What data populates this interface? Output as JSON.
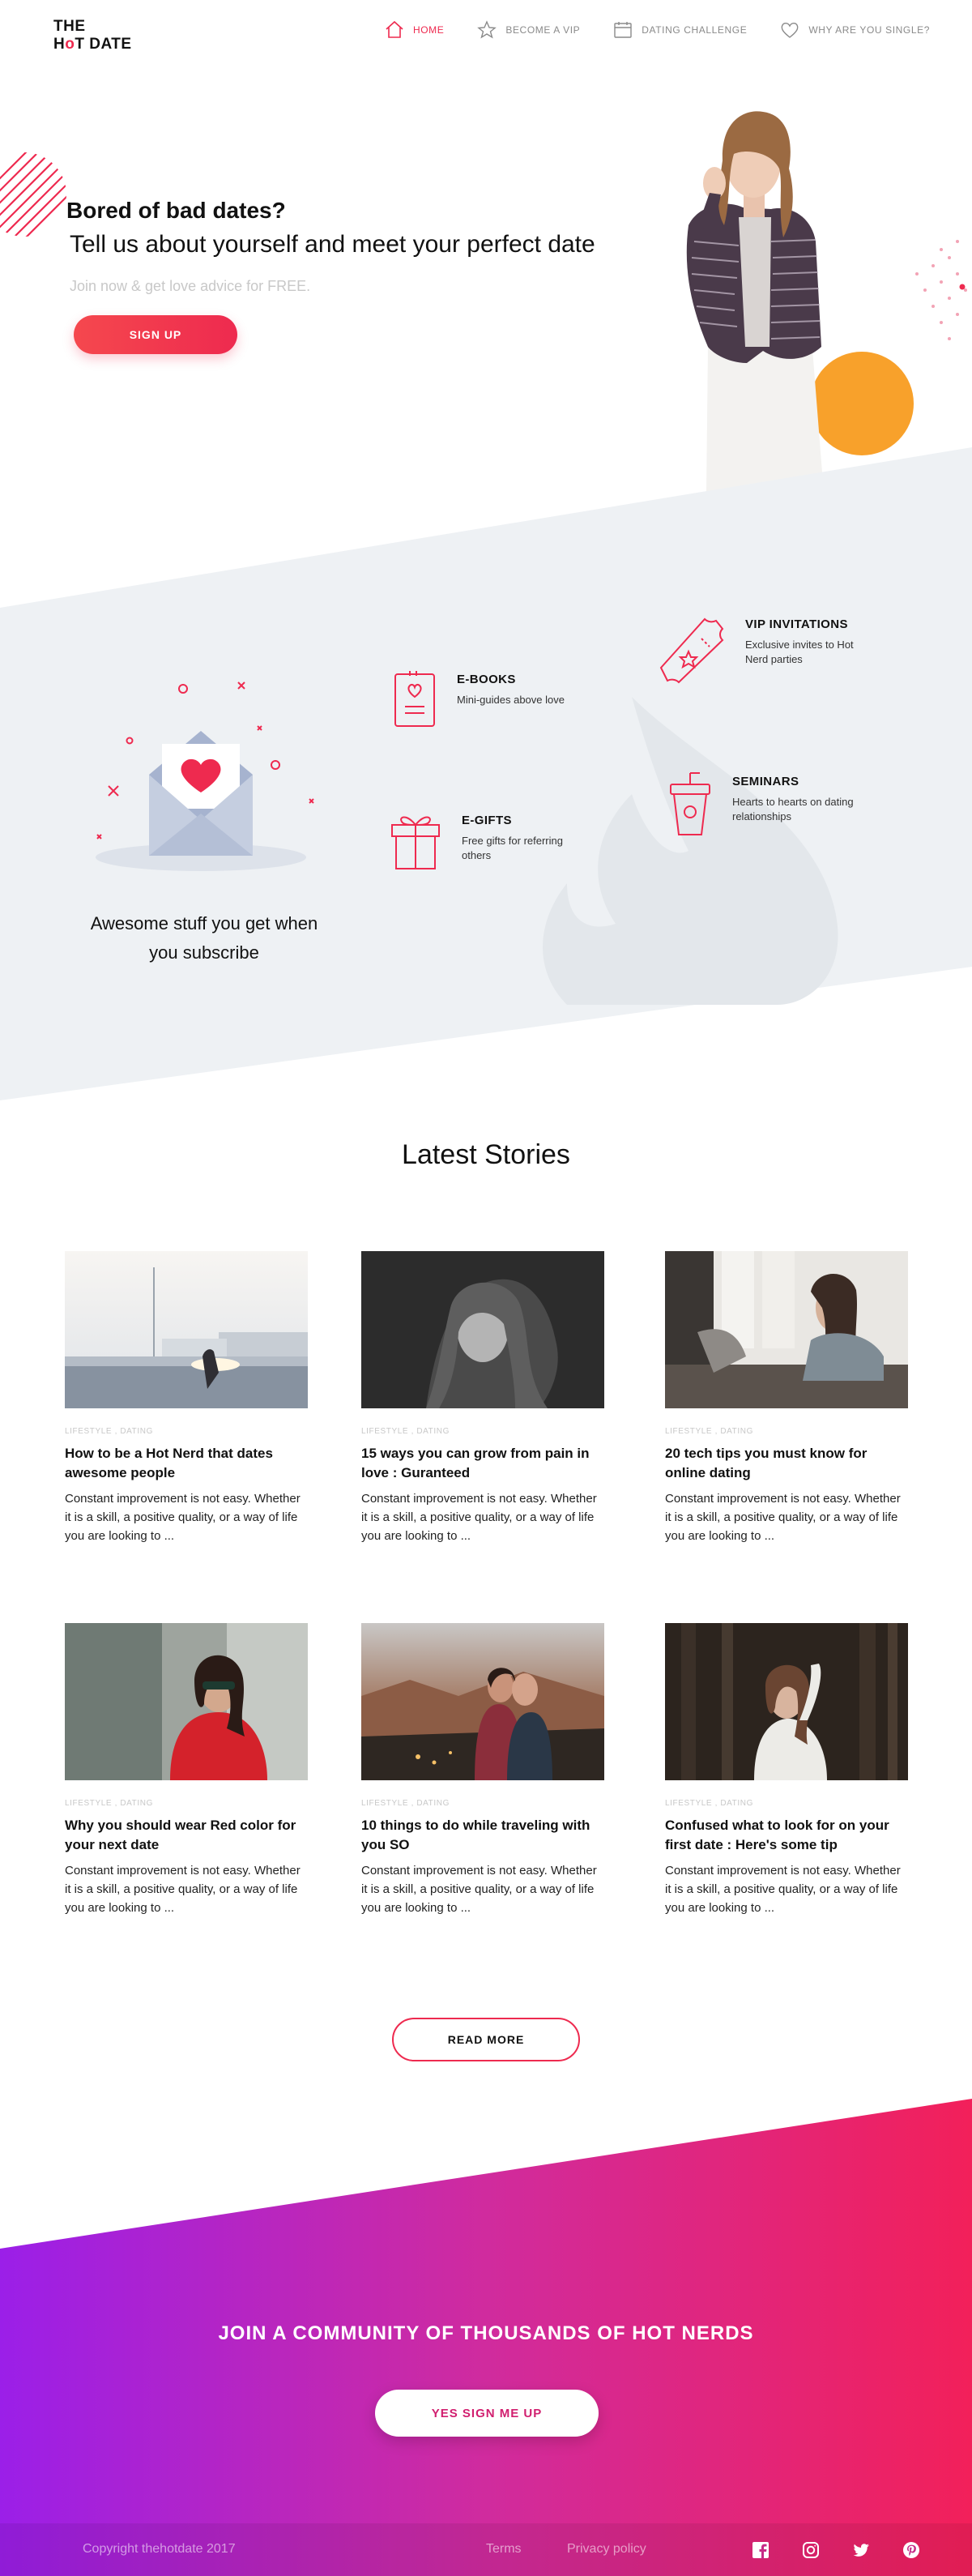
{
  "brand": {
    "line1": "THE",
    "line2_pre": "H",
    "line2_o": "o",
    "line2_post": "T DATE"
  },
  "nav": [
    {
      "label": "HOME",
      "icon": "home-icon",
      "active": true
    },
    {
      "label": "BECOME A VIP",
      "icon": "star-icon"
    },
    {
      "label": "DATING CHALLENGE",
      "icon": "calendar-icon"
    },
    {
      "label": "WHY ARE YOU SINGLE?",
      "icon": "heart-icon"
    }
  ],
  "hero": {
    "title": "Bored of bad dates?",
    "subtitle": "Tell us about yourself and meet your perfect date",
    "note": "Join now & get love advice for FREE.",
    "cta": "SIGN UP"
  },
  "features": {
    "subscribe_text": "Awesome stuff you get when you subscribe",
    "items": [
      {
        "title": "E-BOOKS",
        "desc": "Mini-guides above love",
        "icon": "ebook-icon"
      },
      {
        "title": "E-GIFTS",
        "desc": "Free gifts for referring others",
        "icon": "gift-icon"
      },
      {
        "title": "VIP INVITATIONS",
        "desc": "Exclusive invites to Hot Nerd parties",
        "icon": "ticket-icon"
      },
      {
        "title": "SEMINARS",
        "desc": "Hearts to hearts on dating relationships",
        "icon": "drink-icon"
      }
    ]
  },
  "stories": {
    "title": "Latest Stories",
    "read_more": "READ MORE",
    "items": [
      {
        "category": "LIFESTYLE , DATING",
        "title": "How to be a Hot Nerd that dates awesome people",
        "excerpt": "Constant improvement is not easy. Whether it is a skill, a positive quality, or a way of life you are looking to ..."
      },
      {
        "category": "LIFESTYLE , DATING",
        "title": "15 ways you can grow from pain in love : Guranteed",
        "excerpt": "Constant improvement is not easy. Whether it is a skill, a positive quality, or a way of life you are looking to ..."
      },
      {
        "category": "LIFESTYLE , DATING",
        "title": "20 tech tips you must know for online dating",
        "excerpt": "Constant improvement is not easy. Whether it is a skill, a positive quality, or a way of life you are looking to ..."
      },
      {
        "category": "LIFESTYLE , DATING",
        "title": "Why you should wear Red color for your next date",
        "excerpt": "Constant improvement is not easy. Whether it is a skill, a positive quality, or a way of life you are looking to ..."
      },
      {
        "category": "LIFESTYLE , DATING",
        "title": "10 things to do while traveling with you SO",
        "excerpt": "Constant improvement is not easy. Whether it is a skill, a positive quality, or a way of life you are looking to ..."
      },
      {
        "category": "LIFESTYLE , DATING",
        "title": "Confused what to look for on your first date : Here's some tip",
        "excerpt": "Constant improvement is not easy. Whether it is a skill, a positive quality, or a way of life you are looking to ..."
      }
    ]
  },
  "community": {
    "title": "JOIN A COMMUNITY OF THOUSANDS OF HOT NERDS",
    "cta": "YES SIGN ME UP"
  },
  "footer": {
    "copyright": "Copyright thehotdate 2017",
    "links": [
      "Terms",
      "Privacy policy"
    ],
    "social": [
      "facebook-icon",
      "instagram-icon",
      "twitter-icon",
      "pinterest-icon"
    ]
  },
  "colors": {
    "accent": "#ee2a4f",
    "gradient_start": "#9b1fe8",
    "gradient_end": "#f2205a",
    "panel": "#eef1f4"
  }
}
